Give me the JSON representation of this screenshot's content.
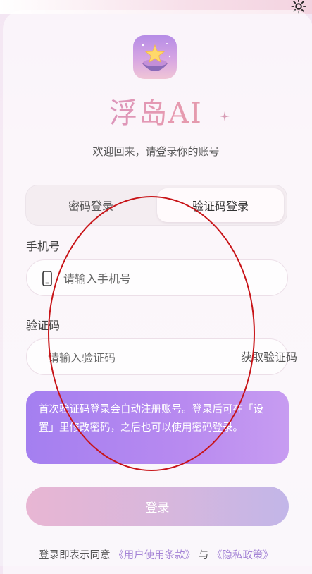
{
  "app": {
    "brand": "浮岛AI",
    "welcome": "欢迎回来，请登录你的账号",
    "logo_icon": "floating-island-star-logo",
    "settings_icon": "gear-icon"
  },
  "tabs": [
    {
      "label": "密码登录",
      "active": false
    },
    {
      "label": "验证码登录",
      "active": true
    }
  ],
  "phone": {
    "label": "手机号",
    "placeholder": "请输入手机号",
    "value": "",
    "icon": "phone-icon"
  },
  "code": {
    "label": "验证码",
    "placeholder": "请输入验证码",
    "value": "",
    "get_code_label": "获取验证码"
  },
  "notice": "首次验证码登录会自动注册账号。登录后可在「设置」里修改密码，之后也可以使用密码登录。",
  "login_button": "登录",
  "agreement": {
    "prefix": "登录即表示同意",
    "terms": "《用户使用条款》",
    "conjunction": "与",
    "privacy": "《隐私政策》"
  },
  "colors": {
    "accent_purple": "#a47ff0",
    "link": "#a483d6",
    "annotation": "#c81418"
  }
}
